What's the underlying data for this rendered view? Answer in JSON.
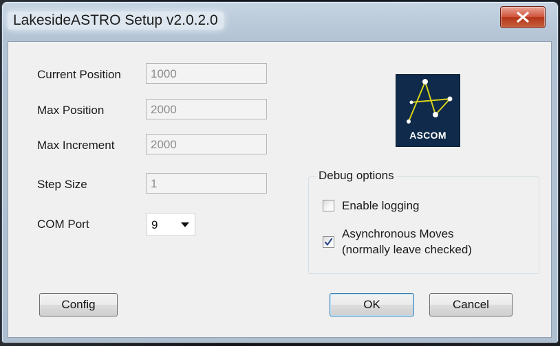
{
  "window": {
    "title": "LakesideASTRO Setup v2.0.2.0"
  },
  "fields": [
    {
      "label": "Current Position",
      "value": "1000"
    },
    {
      "label": "Max Position",
      "value": "2000"
    },
    {
      "label": "Max Increment",
      "value": "2000"
    },
    {
      "label": "Step Size",
      "value": "1"
    }
  ],
  "com_port": {
    "label": "COM Port",
    "selected": "9"
  },
  "logo": {
    "text": "ASCOM"
  },
  "debug": {
    "title": "Debug options",
    "enable_logging": {
      "label": "Enable logging",
      "checked": false
    },
    "async_moves": {
      "label_line1": "Asynchronous  Moves",
      "label_line2": "(normally leave checked)",
      "checked": true
    }
  },
  "buttons": {
    "config": "Config",
    "ok": "OK",
    "cancel": "Cancel"
  },
  "colors": {
    "close_button": "#c8482a",
    "logo_background": "#0f2a4a",
    "logo_star_lines": "#d9d21a"
  },
  "icons": {
    "close": "close-x-icon",
    "dropdown": "chevron-down-icon",
    "check": "check-icon"
  }
}
